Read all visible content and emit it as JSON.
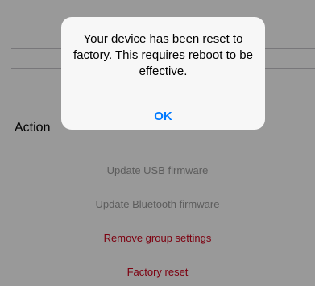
{
  "settings": {
    "section_header": "Action",
    "rows": [
      {
        "label": "Update USB firmware",
        "color": "#9b9b9b"
      },
      {
        "label": "Update Bluetooth firmware",
        "color": "#9b9b9b"
      },
      {
        "label": "Remove group settings",
        "color": "#d0021b"
      },
      {
        "label": "Factory reset",
        "color": "#d0021b"
      }
    ]
  },
  "alert": {
    "message": "Your device has been reset to factory. This requires reboot to be effective.",
    "button_label": "OK",
    "button_color": "#007aff"
  }
}
